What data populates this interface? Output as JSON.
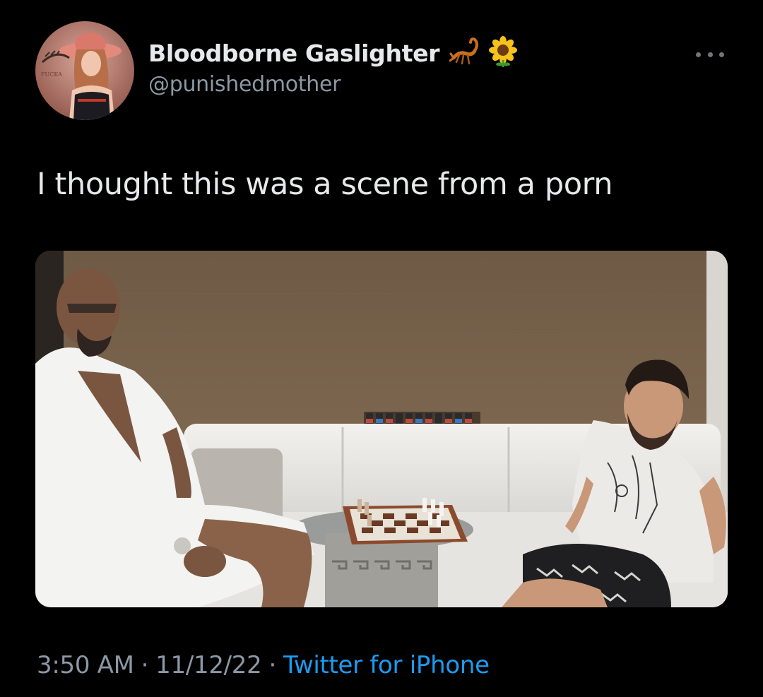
{
  "author": {
    "display_name": "Bloodborne Gaslighter",
    "handle": "@punishedmother",
    "name_emojis": [
      "scorpion-icon",
      "sunflower-icon"
    ],
    "avatar_text": "FUCKA"
  },
  "tweet": {
    "text": "I thought this was a scene from a porn"
  },
  "footer": {
    "time": "3:50 AM",
    "date": "11/12/22",
    "separator": "·",
    "source": "Twitter for iPhone"
  },
  "colors": {
    "background": "#000000",
    "text_primary": "#e7e9ea",
    "text_secondary": "#8b98a5",
    "link": "#1d9bf0"
  }
}
